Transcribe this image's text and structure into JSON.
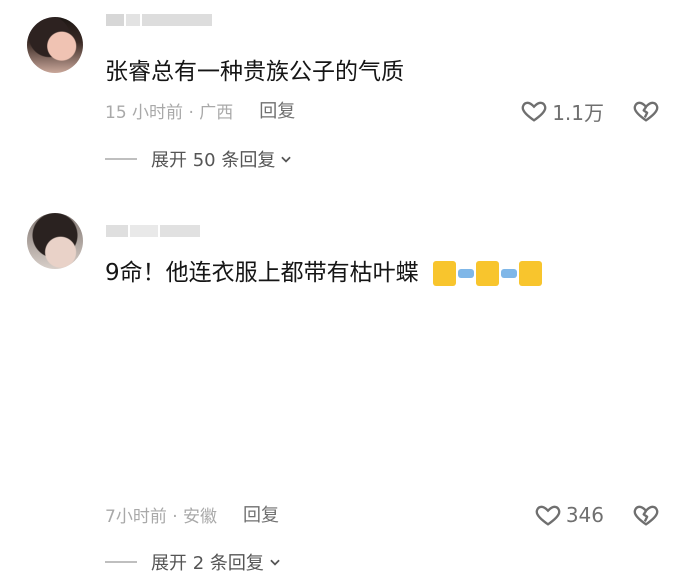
{
  "comments": [
    {
      "text": "张睿总有一种贵族公子的气质",
      "time_location": "15 小时前 · 广西",
      "reply_label": "回复",
      "like_count": "1.1万",
      "expand_text": "展开 50 条回复"
    },
    {
      "text": "9命！他连衣服上都带有枯叶蝶",
      "time_location": "7小时前 · 安徽",
      "reply_label": "回复",
      "like_count": "346",
      "expand_text": "展开 2 条回复"
    }
  ]
}
